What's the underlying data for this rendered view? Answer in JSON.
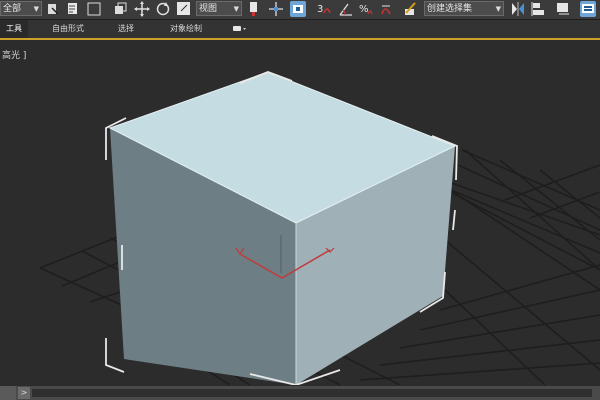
{
  "toolbar": {
    "selection_filter": "全部",
    "reference_coord": "视图",
    "named_selection": "创建选择集"
  },
  "tabs": [
    {
      "label": "工具"
    },
    {
      "label": "自由形式"
    },
    {
      "label": "选择"
    },
    {
      "label": "对象绘制"
    }
  ],
  "viewport": {
    "label": "高光 ]"
  },
  "timeline": {
    "scroll_glyph": ">"
  },
  "colors": {
    "accent_gold": "#c9a227",
    "active_icon": "#6fa6d8",
    "box_top": "#c5dde2",
    "box_front": "#6d7e84",
    "box_side": "#9fb1b6"
  }
}
